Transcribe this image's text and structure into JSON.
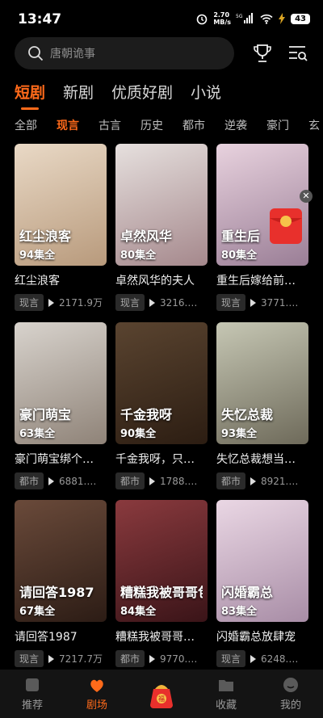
{
  "status": {
    "time": "13:47",
    "speed_value": "2.70",
    "speed_unit": "MB/s",
    "battery": "43"
  },
  "search": {
    "placeholder": "唐朝诡事"
  },
  "tabs": [
    {
      "label": "短剧",
      "active": true
    },
    {
      "label": "新剧"
    },
    {
      "label": "优质好剧"
    },
    {
      "label": "小说"
    }
  ],
  "genres": [
    {
      "label": "全部"
    },
    {
      "label": "现言",
      "active": true
    },
    {
      "label": "古言"
    },
    {
      "label": "历史"
    },
    {
      "label": "都市"
    },
    {
      "label": "逆袭"
    },
    {
      "label": "豪门"
    },
    {
      "label": "玄"
    }
  ],
  "cards": [
    {
      "title": "红尘浪客",
      "episodes": "94集全",
      "tag": "现言",
      "plays": "2171.9万",
      "poster_text": "红尘浪客",
      "colors": [
        "#e9d9c6",
        "#b89a7c"
      ]
    },
    {
      "title": "卓然风华的夫人",
      "episodes": "80集全",
      "tag": "现言",
      "plays": "3216.…",
      "poster_text": "卓然风华",
      "colors": [
        "#e6e0de",
        "#a5888c"
      ]
    },
    {
      "title": "重生后嫁给前…",
      "episodes": "80集全",
      "tag": "现言",
      "plays": "3771.…",
      "poster_text": "重生后",
      "colors": [
        "#e8d2de",
        "#9a7e96"
      ]
    },
    {
      "title": "豪门萌宝绑个…",
      "episodes": "63集全",
      "tag": "都市",
      "plays": "6881.…",
      "poster_text": "豪门萌宝",
      "colors": [
        "#d8d3cd",
        "#8f8378"
      ]
    },
    {
      "title": "千金我呀，只…",
      "episodes": "90集全",
      "tag": "都市",
      "plays": "1788.…",
      "poster_text": "千金我呀",
      "colors": [
        "#5a4430",
        "#2c1d12"
      ]
    },
    {
      "title": "失忆总裁想当…",
      "episodes": "93集全",
      "tag": "都市",
      "plays": "8921.…",
      "poster_text": "失忆总裁",
      "colors": [
        "#c6c7b4",
        "#6e6a5a"
      ]
    },
    {
      "title": "请回答1987",
      "episodes": "67集全",
      "tag": "现言",
      "plays": "7217.7万",
      "poster_text": "请回答1987",
      "colors": [
        "#6a4a3a",
        "#2c1c15"
      ]
    },
    {
      "title": "糟糕我被哥哥…",
      "episodes": "84集全",
      "tag": "都市",
      "plays": "9770.…",
      "poster_text": "糟糕我被哥哥包了",
      "colors": [
        "#8a3a3e",
        "#3a1418"
      ]
    },
    {
      "title": "闪婚霸总放肆宠",
      "episodes": "83集全",
      "tag": "现言",
      "plays": "6248.…",
      "poster_text": "闪婚霸总",
      "colors": [
        "#ead7e4",
        "#a88da6"
      ]
    }
  ],
  "nav": [
    {
      "label": "推荐",
      "icon": "recommend-icon"
    },
    {
      "label": "剧场",
      "icon": "theater-icon",
      "active": true
    },
    {
      "label": "",
      "icon": "lucky-bag-icon"
    },
    {
      "label": "收藏",
      "icon": "folder-icon"
    },
    {
      "label": "我的",
      "icon": "profile-icon"
    }
  ],
  "accent": "#ff6a1a"
}
